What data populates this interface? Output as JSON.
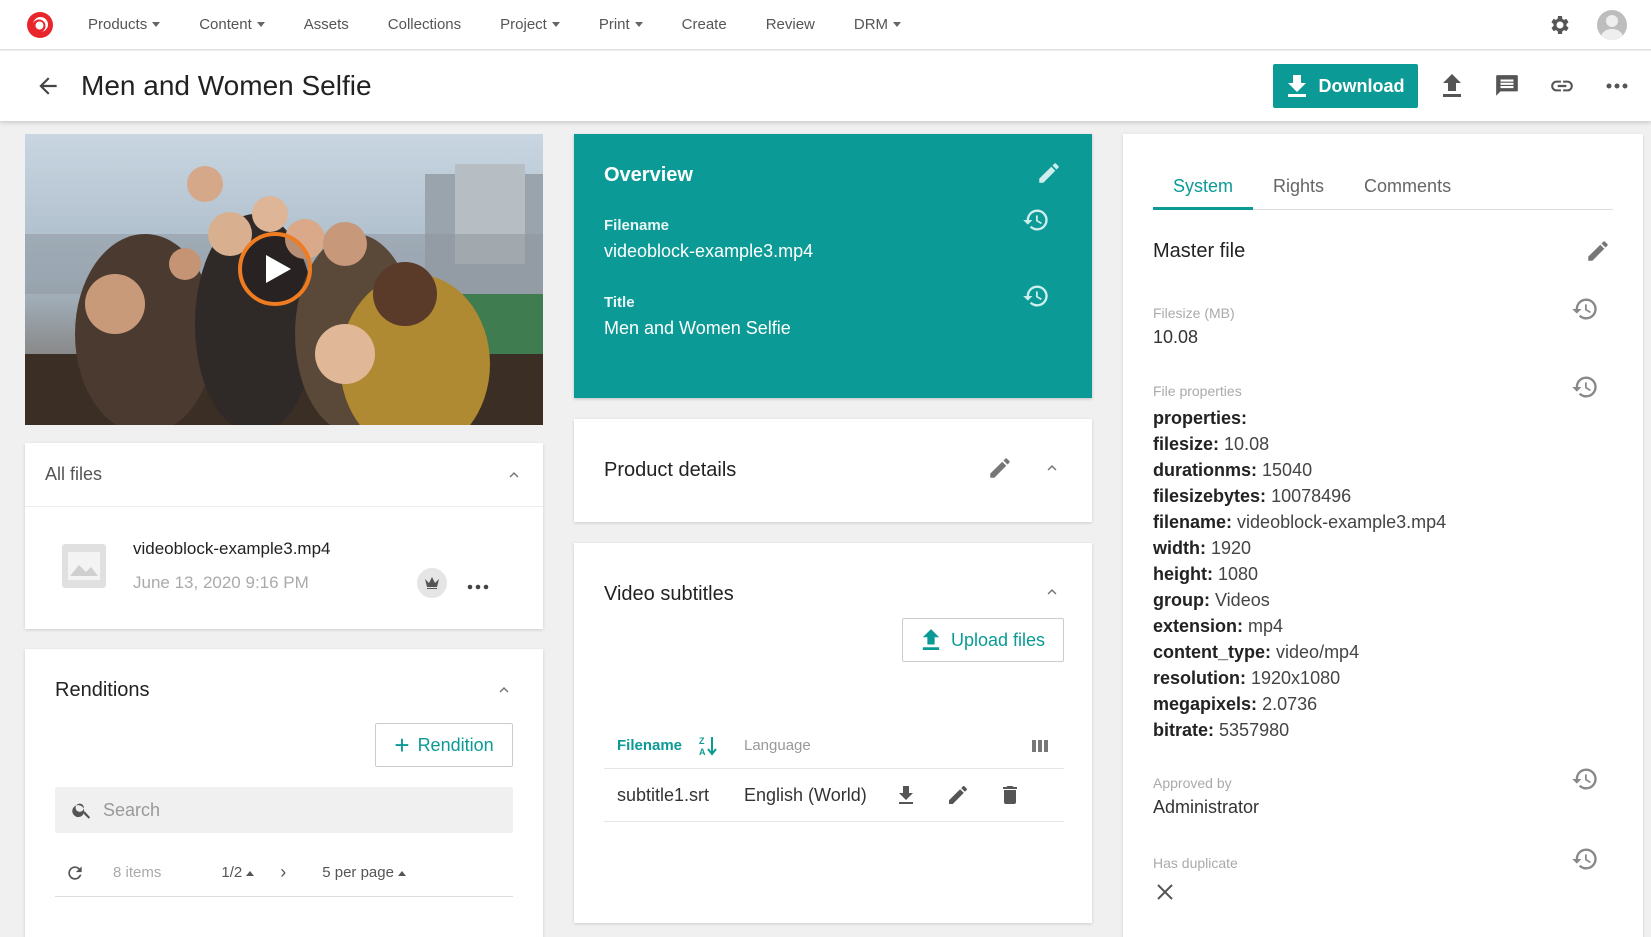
{
  "nav": {
    "items": [
      {
        "label": "Products",
        "dropdown": true
      },
      {
        "label": "Content",
        "dropdown": true
      },
      {
        "label": "Assets",
        "dropdown": false
      },
      {
        "label": "Collections",
        "dropdown": false
      },
      {
        "label": "Project",
        "dropdown": true
      },
      {
        "label": "Print",
        "dropdown": true
      },
      {
        "label": "Create",
        "dropdown": false
      },
      {
        "label": "Review",
        "dropdown": false
      },
      {
        "label": "DRM",
        "dropdown": true
      }
    ]
  },
  "header": {
    "title": "Men and Women Selfie",
    "download_label": "Download"
  },
  "all_files": {
    "title": "All files",
    "file": {
      "name": "videoblock-example3.mp4",
      "date": "June 13, 2020 9:16 PM"
    }
  },
  "renditions": {
    "title": "Renditions",
    "add_label": "Rendition",
    "search_placeholder": "Search",
    "count": "8 items",
    "page": "1/2",
    "per_page": "5 per page"
  },
  "overview": {
    "title": "Overview",
    "filename_label": "Filename",
    "filename_value": "videoblock-example3.mp4",
    "title_label": "Title",
    "title_value": "Men and Women Selfie"
  },
  "product_details": {
    "title": "Product details"
  },
  "video_subtitles": {
    "title": "Video subtitles",
    "upload_label": "Upload files",
    "col_filename": "Filename",
    "col_language": "Language",
    "rows": [
      {
        "filename": "subtitle1.srt",
        "language": "English (World)"
      }
    ]
  },
  "system": {
    "tabs": [
      "System",
      "Rights",
      "Comments"
    ],
    "active_tab": "System",
    "master_file": "Master file",
    "filesize_label": "Filesize (MB)",
    "filesize_value": "10.08",
    "props_label": "File properties",
    "props_header": "properties:",
    "properties": [
      {
        "key": "filesize:",
        "value": "10.08"
      },
      {
        "key": "durationms:",
        "value": "15040"
      },
      {
        "key": "filesizebytes:",
        "value": "10078496"
      },
      {
        "key": "filename:",
        "value": "videoblock-example3.mp4"
      },
      {
        "key": "width:",
        "value": "1920"
      },
      {
        "key": "height:",
        "value": "1080"
      },
      {
        "key": "group:",
        "value": "Videos"
      },
      {
        "key": "extension:",
        "value": "mp4"
      },
      {
        "key": "content_type:",
        "value": "video/mp4"
      },
      {
        "key": "resolution:",
        "value": "1920x1080"
      },
      {
        "key": "megapixels:",
        "value": "2.0736"
      },
      {
        "key": "bitrate:",
        "value": "5357980"
      }
    ],
    "approved_label": "Approved by",
    "approved_value": "Administrator",
    "duplicate_label": "Has duplicate"
  },
  "colors": {
    "accent": "#0b9a95",
    "play_ring": "#f07c22"
  }
}
